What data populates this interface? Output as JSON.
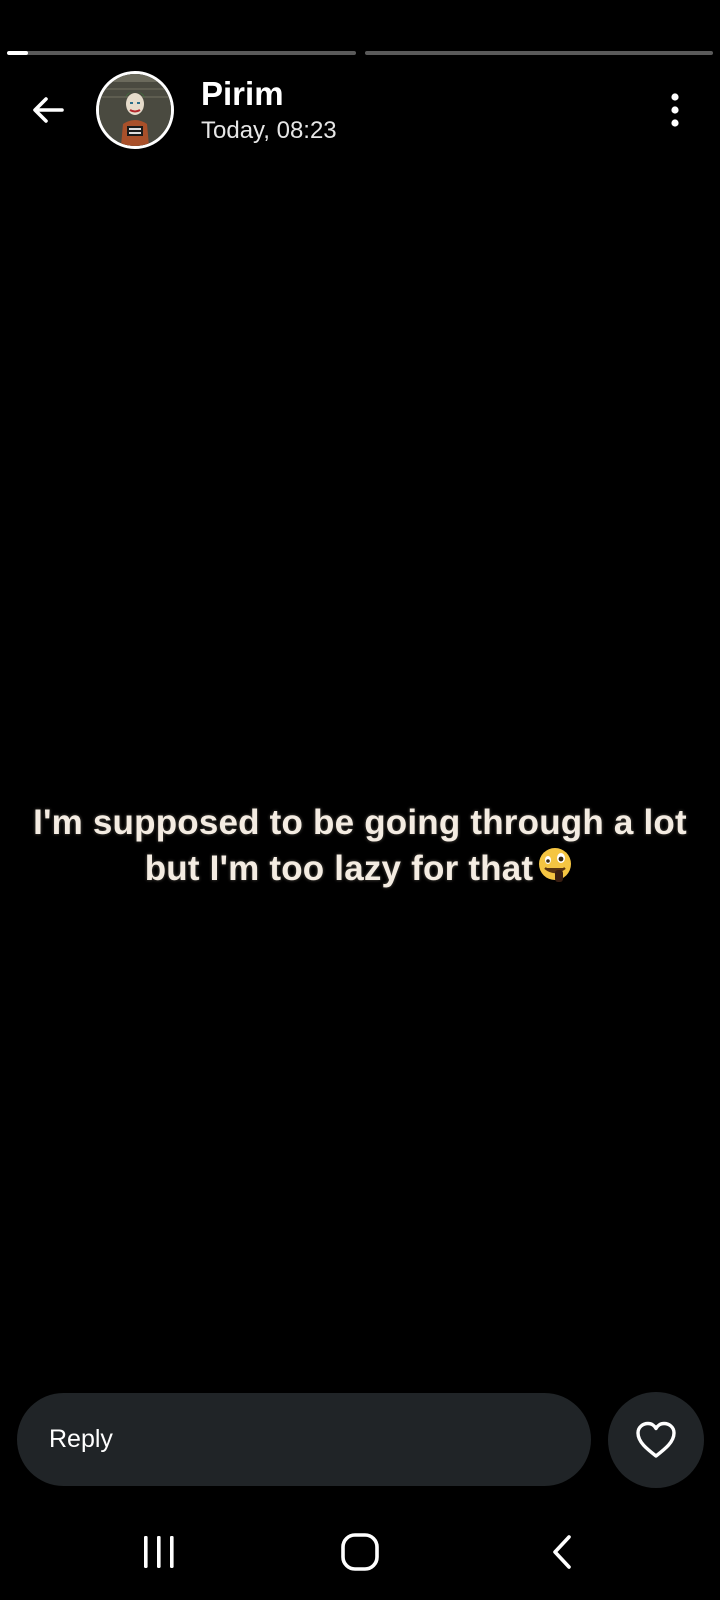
{
  "stories": {
    "segments": [
      {
        "progress": 0.06
      },
      {
        "progress": 0.0
      }
    ]
  },
  "header": {
    "name": "Pirim",
    "time": "Today, 08:23",
    "back_icon": "arrow-left-icon",
    "more_icon": "more-vertical-icon"
  },
  "story": {
    "line1": "I'm supposed to be going through a lot",
    "line2": "but I'm too lazy for that",
    "emoji": "zany-face-emoji"
  },
  "footer": {
    "reply_placeholder": "Reply",
    "like_icon": "heart-outline-icon"
  },
  "navbar": {
    "recents_icon": "recent-apps-icon",
    "home_icon": "home-icon",
    "back_icon": "nav-back-icon"
  },
  "colors": {
    "background": "#000000",
    "input_bg": "#202427",
    "text": "#ffffff",
    "progress_track": "#5a5a5a",
    "progress_fill": "#ffffff"
  }
}
